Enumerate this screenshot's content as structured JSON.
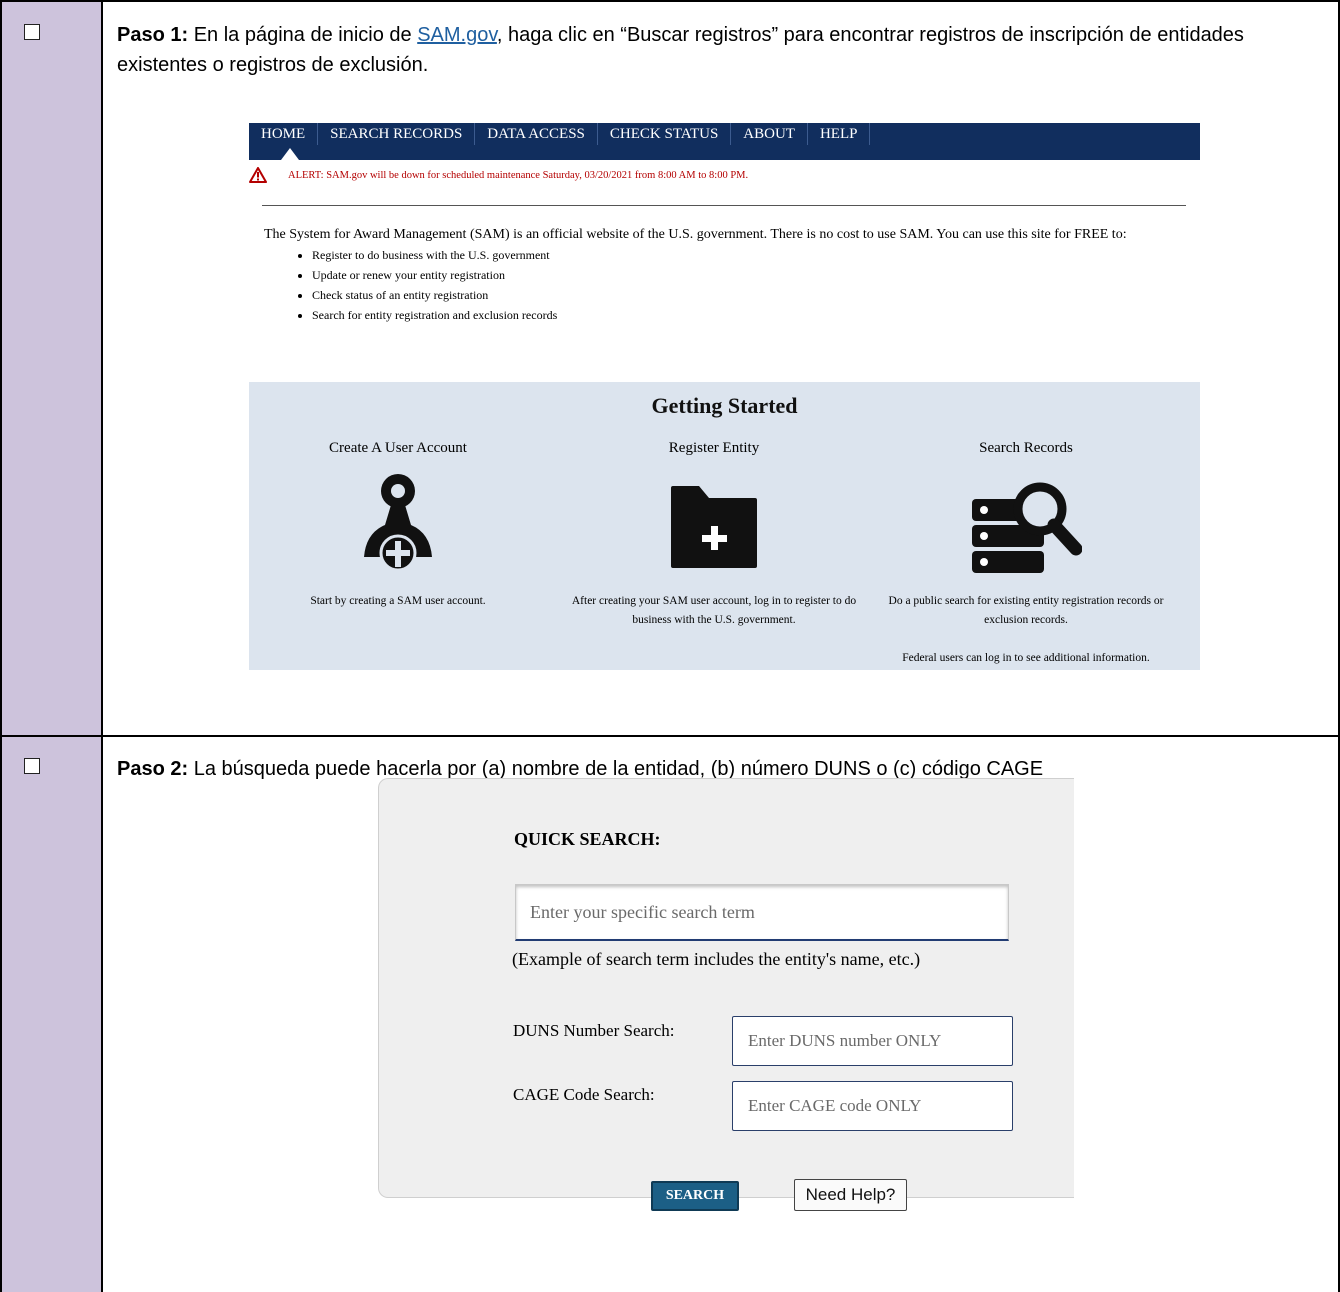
{
  "step1": {
    "label": "Paso 1:",
    "text_before_link": " En la página de inicio de ",
    "link_text": "SAM.gov",
    "text_after_link": ", haga clic en “Buscar registros” para encontrar registros de inscripción de entidades existentes o registros de exclusión."
  },
  "sam_home": {
    "nav": [
      "HOME",
      "SEARCH RECORDS",
      "DATA ACCESS",
      "CHECK STATUS",
      "ABOUT",
      "HELP"
    ],
    "alert": "ALERT: SAM.gov will be down for scheduled maintenance Saturday, 03/20/2021 from 8:00 AM to 8:00 PM.",
    "intro": "The System for Award Management (SAM) is an official website of the U.S. government. There is no cost to use SAM. You can use this site for FREE to:",
    "bullets": [
      "Register to do business with the U.S. government",
      "Update or renew your entity registration",
      "Check status of an entity registration",
      "Search for entity registration and exclusion records"
    ],
    "getting_started": "Getting Started",
    "cards": [
      {
        "title": "Create A User Account",
        "icon": "user-add-icon",
        "desc": "Start by creating a SAM user account.",
        "extra": ""
      },
      {
        "title": "Register Entity",
        "icon": "folder-add-icon",
        "desc": "After creating your SAM user account, log in to register to do business with the U.S. government.",
        "extra": ""
      },
      {
        "title": "Search Records",
        "icon": "database-search-icon",
        "desc": "Do a public search for existing entity registration records or exclusion records.",
        "extra": "Federal users can log in to see additional information."
      }
    ]
  },
  "step2": {
    "label": "Paso 2:",
    "text": " La búsqueda puede hacerla por (a) nombre de la entidad, (b) número DUNS o (c) código CAGE"
  },
  "quick_search": {
    "title": "QUICK SEARCH:",
    "main_placeholder": "Enter your specific search term",
    "example": "(Example of search term includes the entity's name, etc.)",
    "duns_label": "DUNS Number Search:",
    "duns_placeholder": "Enter DUNS number ONLY",
    "cage_label": "CAGE Code Search:",
    "cage_placeholder": "Enter CAGE code ONLY",
    "search_button": "SEARCH",
    "help_button": "Need Help?"
  },
  "colors": {
    "side_column": "#cdc3dc",
    "navbar": "#112e5e",
    "alert": "#b40000",
    "getting_started_bg": "#dce4ee",
    "search_button": "#1c5f86",
    "link": "#1f5fa0"
  }
}
